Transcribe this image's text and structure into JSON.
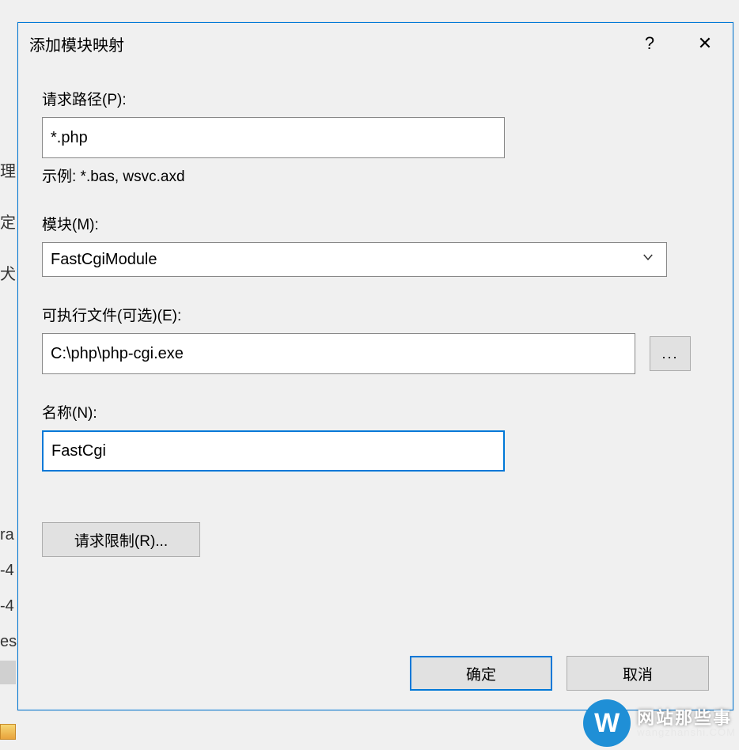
{
  "titlebar": {
    "title": "添加模块映射",
    "help": "?",
    "close": "✕"
  },
  "request_path": {
    "label": "请求路径(P):",
    "value": "*.php",
    "example": "示例: *.bas, wsvc.axd"
  },
  "module": {
    "label": "模块(M):",
    "value": "FastCgiModule"
  },
  "executable": {
    "label": "可执行文件(可选)(E):",
    "value": "C:\\php\\php-cgi.exe",
    "browse": "..."
  },
  "name": {
    "label": "名称(N):",
    "value": "FastCgi"
  },
  "request_restrict": "请求限制(R)...",
  "buttons": {
    "ok": "确定",
    "cancel": "取消"
  },
  "watermark": {
    "letter": "W",
    "cn": "网站那些事",
    "en": "wangzhanshi.COM"
  },
  "bg": {
    "h1": "理",
    "h2": "定",
    "h3": "犬",
    "h4": "ra",
    "h5": "-4",
    "h6": "-4",
    "h7": "es"
  }
}
